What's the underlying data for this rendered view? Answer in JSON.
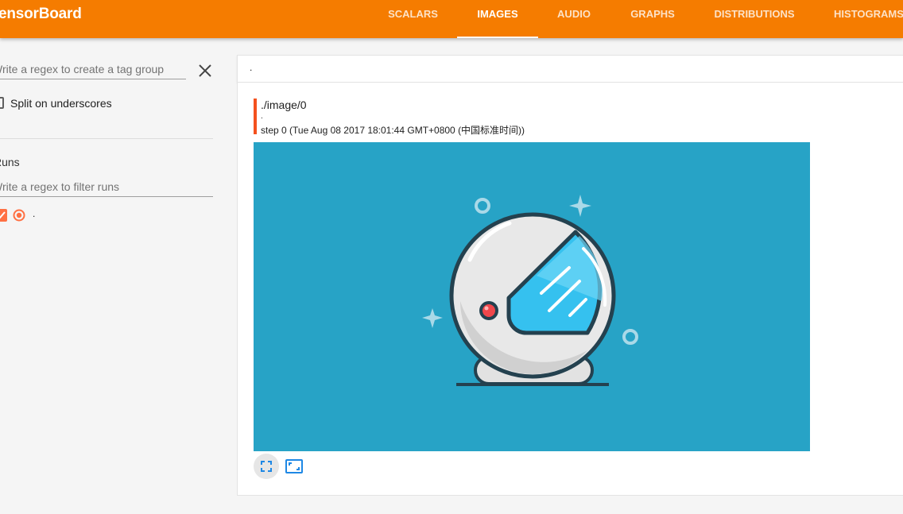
{
  "app": {
    "title": "TensorBoard"
  },
  "nav": {
    "tabs": [
      {
        "label": "SCALARS",
        "active": false
      },
      {
        "label": "IMAGES",
        "active": true
      },
      {
        "label": "AUDIO",
        "active": false
      },
      {
        "label": "GRAPHS",
        "active": false
      },
      {
        "label": "DISTRIBUTIONS",
        "active": false
      },
      {
        "label": "HISTOGRAMS",
        "active": false
      }
    ]
  },
  "sidebar": {
    "tag_regex": {
      "value": "",
      "placeholder": "Write a regex to create a tag group"
    },
    "split_on_underscores": {
      "label": "Split on underscores",
      "checked": false
    },
    "runs": {
      "title": "Runs",
      "filter": {
        "value": "",
        "placeholder": "Write a regex to filter runs"
      },
      "items": [
        {
          "name": ".",
          "checked": true,
          "color": "#ff7043"
        }
      ]
    }
  },
  "main": {
    "tag_group": {
      "label": "."
    },
    "card": {
      "tag": "./image/0",
      "run": ".",
      "step_info": "step 0 (Tue Aug 08 2017 18:01:44 GMT+0800 (中国标准时间))",
      "accent_color": "#f4511e",
      "image": {
        "icon": "astronaut-helmet-illustration",
        "background": "#27a3c6"
      }
    },
    "buttons": {
      "expand": {
        "icon": "fullscreen-icon"
      },
      "actual_size": {
        "icon": "actual-size-icon"
      }
    }
  },
  "colors": {
    "brand": "#f57c00",
    "run_color": "#ff7043",
    "accent": "#f4511e"
  }
}
